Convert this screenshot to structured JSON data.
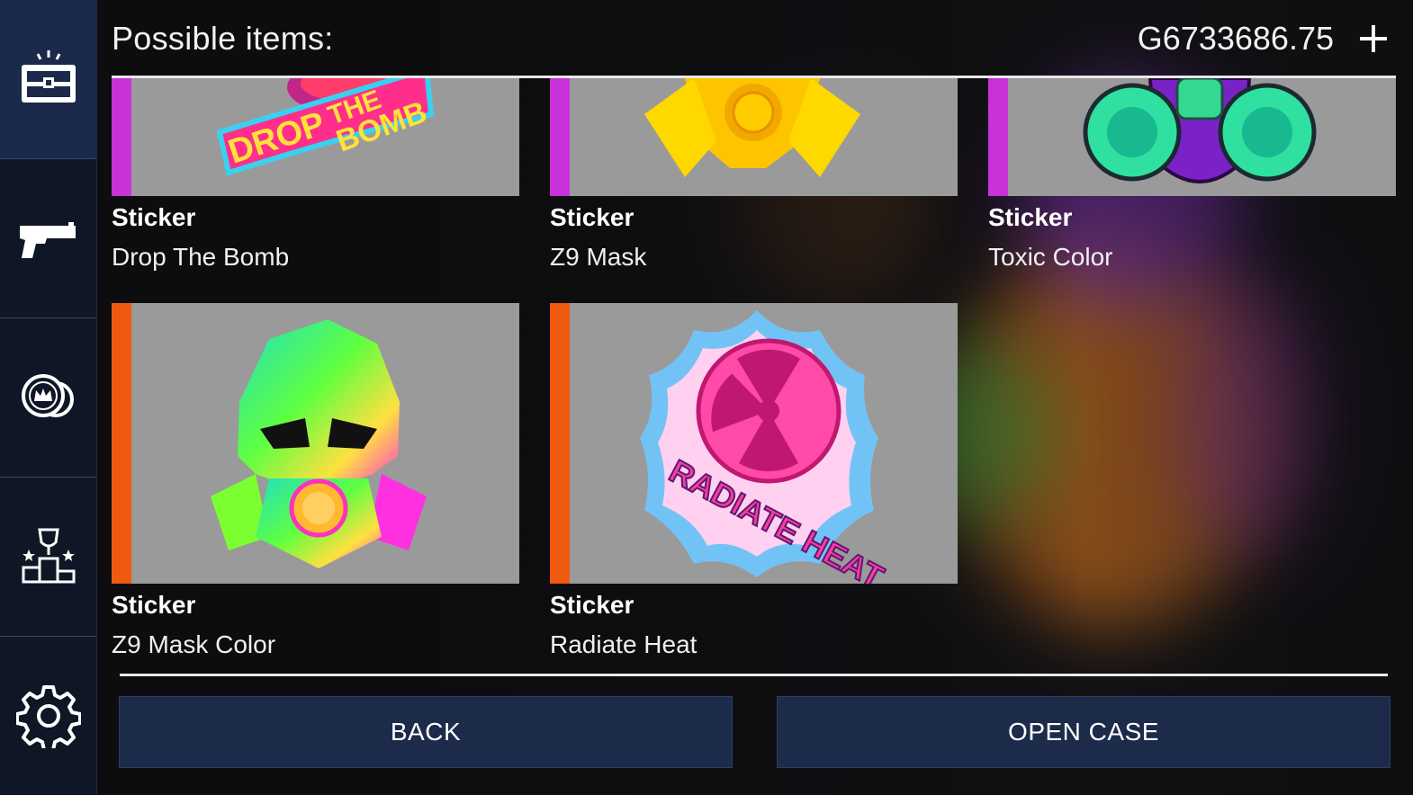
{
  "header": {
    "title": "Possible items:",
    "balance": "G6733686.75"
  },
  "sidebar": {
    "items": [
      {
        "icon": "case-icon",
        "active": true
      },
      {
        "icon": "pistol-icon",
        "active": false
      },
      {
        "icon": "coins-icon",
        "active": false
      },
      {
        "icon": "trophy-podium-icon",
        "active": false
      },
      {
        "icon": "gear-icon",
        "active": false
      }
    ]
  },
  "items": [
    {
      "type": "Sticker",
      "name": "Drop The Bomb",
      "rarity_color": "#c832d8"
    },
    {
      "type": "Sticker",
      "name": "Z9 Mask",
      "rarity_color": "#c832d8"
    },
    {
      "type": "Sticker",
      "name": "Toxic Color",
      "rarity_color": "#c832d8"
    },
    {
      "type": "Sticker",
      "name": "Z9 Mask Color",
      "rarity_color": "#f05a10"
    },
    {
      "type": "Sticker",
      "name": "Radiate Heat",
      "rarity_color": "#f05a10"
    }
  ],
  "sticker_text": {
    "drop_the_bomb": [
      "DROP",
      "THE",
      "BOMB"
    ],
    "radiate_heat": "RADIATE HEAT"
  },
  "buttons": {
    "back": "BACK",
    "open_case": "OPEN CASE"
  },
  "colors": {
    "sidebar_bg": "#0f1726",
    "sidebar_active": "#1b2a4a",
    "button_bg": "#1c2b4a",
    "thumb_bg": "#9a9a9a"
  }
}
